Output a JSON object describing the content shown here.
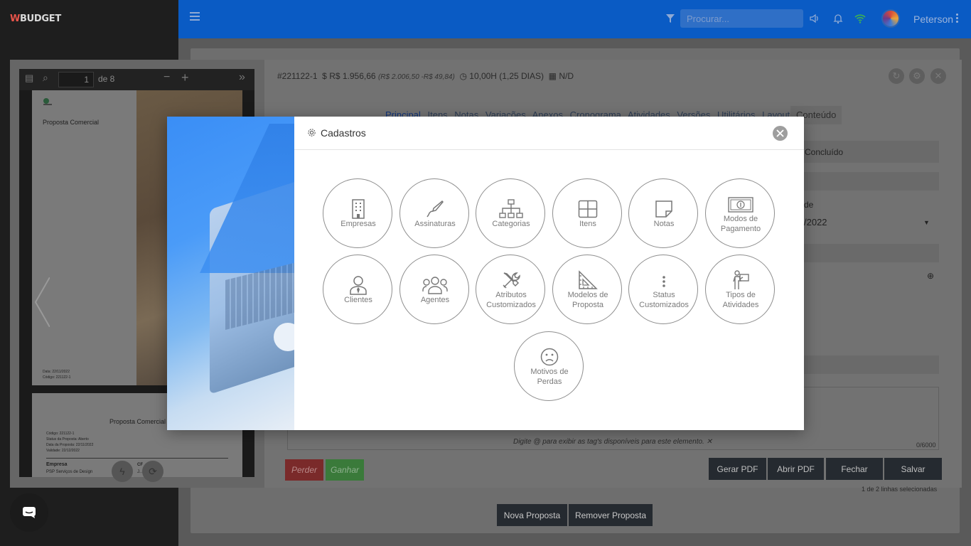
{
  "app": {
    "logo_prefix": "W",
    "logo_text": "BUDGET"
  },
  "topbar": {
    "search_placeholder": "Procurar...",
    "user_name": "Peterson"
  },
  "pdf_viewer": {
    "page_input": "1",
    "page_of": "de 8",
    "page1": {
      "title": "Proposta Comercial",
      "date": "Data: 22/11/2022",
      "code": "Código: 221122-1"
    },
    "page2": {
      "title": "Proposta Comercial",
      "lines": [
        "Código: 221122-1",
        "Status da Proposta: Aberto",
        "Data da Proposta: 22/11/2022",
        "Validade: 22/12/2022"
      ],
      "company_heading": "Empresa",
      "company_name": "PSP Serviços de Design",
      "col2_fragment": "CF",
      "col2_name": "J... ...o Mello"
    }
  },
  "editor": {
    "code": "#221122-1",
    "amount": "R$ 1.956,66",
    "amount_detail": "(R$ 2.006,50 -R$ 49,84)",
    "hours": "10,00H (1,25 DIAS)",
    "date": "N/D",
    "tabs": [
      "Principal",
      "Itens",
      "Notas",
      "Variações",
      "Anexos",
      "Cronograma",
      "Atividades",
      "Versões",
      "Utilitários",
      "Layout"
    ],
    "conteudo_tab": "Conteúdo",
    "status_fragment": "Concluído",
    "label_fragment": "de",
    "date_fragment": "/2022",
    "hint": "Digite @ para exibir as tag's disponíveis para este elemento.",
    "char_count": "0/6000",
    "buttons": {
      "perder": "Perder",
      "ganhar": "Ganhar",
      "gerar_pdf": "Gerar PDF",
      "abrir_pdf": "Abrir PDF",
      "fechar": "Fechar",
      "salvar": "Salvar"
    }
  },
  "list": {
    "selection_info": "1 de 2 linhas selecionadas",
    "nova": "Nova Proposta",
    "remover": "Remover Proposta"
  },
  "modal": {
    "title": "Cadastros",
    "items": [
      {
        "label": "Empresas",
        "icon": "building-icon"
      },
      {
        "label": "Assinaturas",
        "icon": "pen-icon"
      },
      {
        "label": "Categorias",
        "icon": "hierarchy-icon"
      },
      {
        "label": "Itens",
        "icon": "grid-icon"
      },
      {
        "label": "Notas",
        "icon": "note-icon"
      },
      {
        "label": "Modos de Pagamento",
        "icon": "banknote-icon"
      },
      {
        "label": "Clientes",
        "icon": "user-tie-icon"
      },
      {
        "label": "Agentes",
        "icon": "users-icon"
      },
      {
        "label": "Atributos Customizados",
        "icon": "tools-icon"
      },
      {
        "label": "Modelos de Proposta",
        "icon": "set-square-icon"
      },
      {
        "label": "Status Customizados",
        "icon": "vertical-dots-icon"
      },
      {
        "label": "Tipos de Atividades",
        "icon": "person-board-icon"
      },
      {
        "label": "Motivos de Perdas",
        "icon": "sad-face-icon"
      }
    ]
  },
  "colors": {
    "topbar": "#0a5bc4",
    "sidebar": "#1e1e1e",
    "modal_image": "#3a8ef6",
    "circle_border": "#8e8e8e",
    "label": "#7a7a7a"
  }
}
